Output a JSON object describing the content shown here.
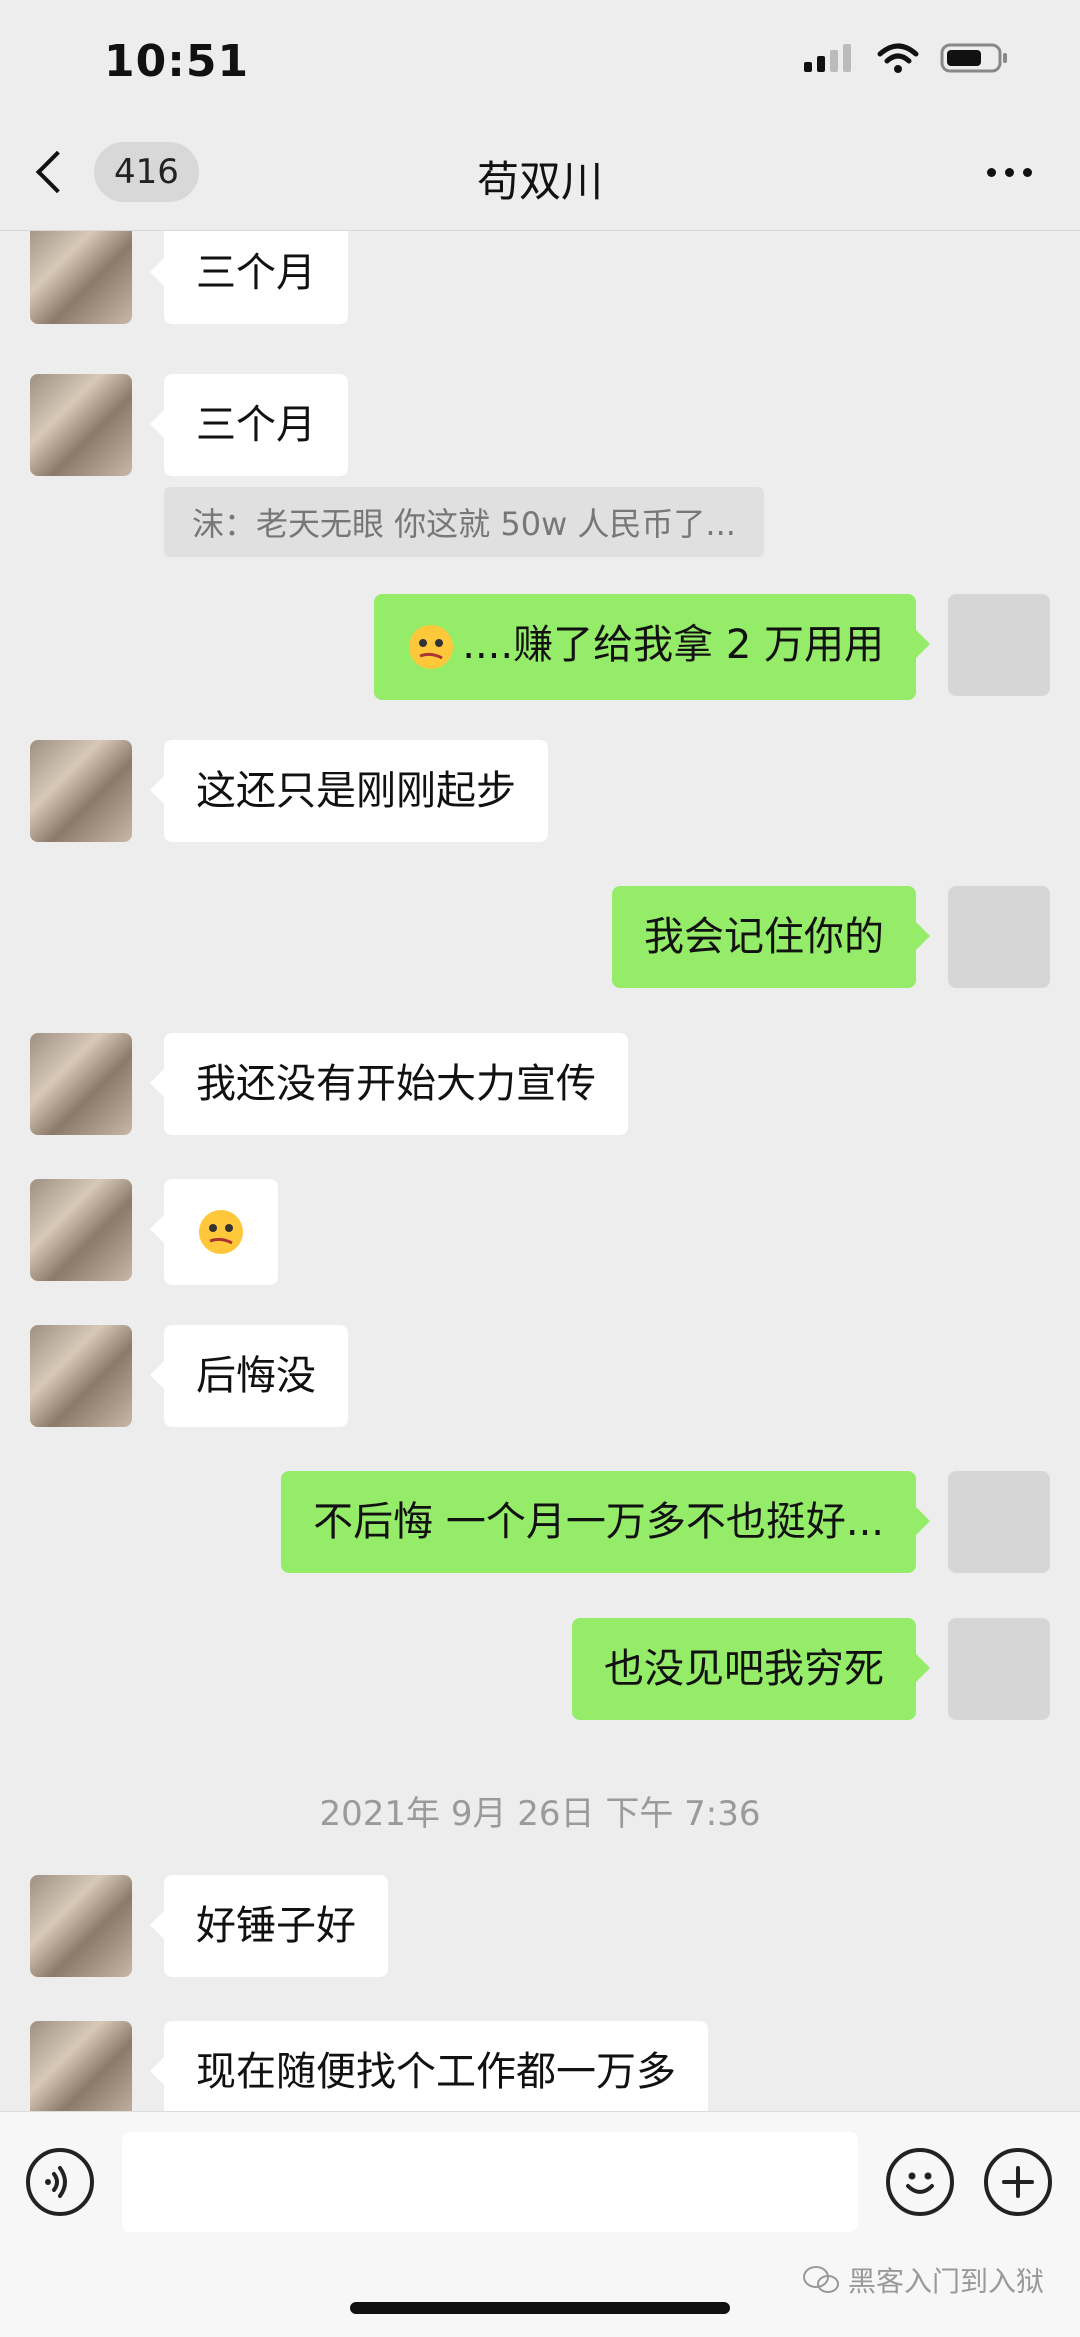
{
  "status_bar": {
    "time": "10:51"
  },
  "nav": {
    "badge": "416",
    "title": "苟双川"
  },
  "messages": [
    {
      "text": "三个月"
    },
    {
      "text": "三个月"
    },
    {
      "quote": "沫：老天无眼 你这就 50w 人民币了..."
    },
    {
      "text": "....赚了给我拿 2 万用用"
    },
    {
      "text": "这还只是刚刚起步"
    },
    {
      "text": "我会记住你的"
    },
    {
      "text": "我还没有开始大力宣传"
    },
    {
      "text": ""
    },
    {
      "text": "后悔没"
    },
    {
      "text": "不后悔 一个月一万多不也挺好..."
    },
    {
      "text": "也没见吧我穷死"
    },
    {
      "timestamp": "2021年 9月 26日 下午 7:36"
    },
    {
      "text": "好锤子好"
    },
    {
      "text": "现在随便找个工作都一万多"
    }
  ],
  "watermark": "黑客入门到入狱",
  "icons": [
    "chevron-left-icon",
    "more-icon",
    "voice-icon",
    "emoji-icon",
    "add-icon",
    "wechat-icon",
    "signal-icon",
    "wifi-icon",
    "battery-icon"
  ]
}
